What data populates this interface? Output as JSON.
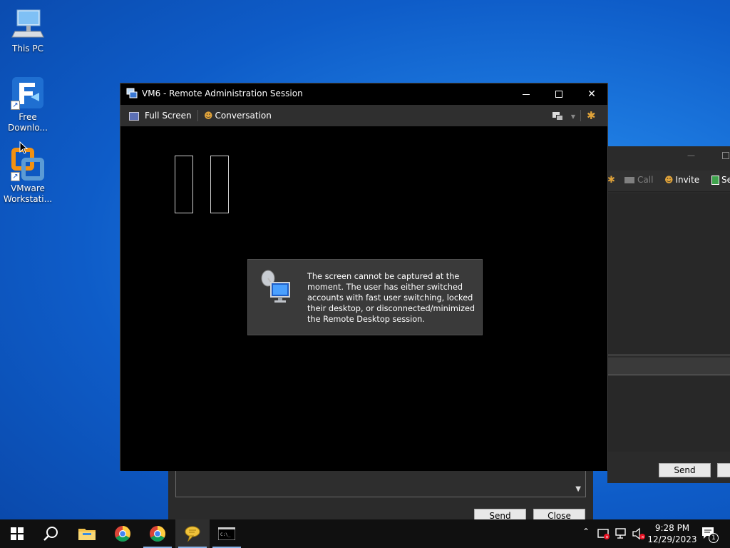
{
  "desktop": {
    "icons": [
      {
        "label": "This PC"
      },
      {
        "label": "Free Downlo..."
      },
      {
        "label": "VMware Workstati..."
      }
    ]
  },
  "vm_window": {
    "title": "VM6 - Remote Administration Session",
    "controls": {
      "minimize": "—",
      "maximize": "☐",
      "close": "✕"
    },
    "toolbar": {
      "full_screen": "Full Screen",
      "conversation": "Conversation"
    },
    "message": "The screen cannot be captured at the moment. The user has either switched accounts with fast user switching, locked their desktop, or disconnected/minimized the Remote Desktop session."
  },
  "bg_window": {
    "toolbar": {
      "call": "Call",
      "invite": "Invite",
      "send_file": "Se"
    },
    "send_button": "Send",
    "controls": {
      "minimize": "—"
    }
  },
  "conversation_window": {
    "send_button": "Send",
    "close_button": "Close"
  },
  "taskbar": {
    "clock_time": "9:28 PM",
    "clock_date": "12/29/2023",
    "notification_count": "1"
  },
  "colors": {
    "desktop_blue": "#0e5cc8",
    "titlebar": "#000000",
    "toolbar": "#2f2f2f",
    "message_panel": "#3a3a3a",
    "taskbar": "#101010"
  }
}
